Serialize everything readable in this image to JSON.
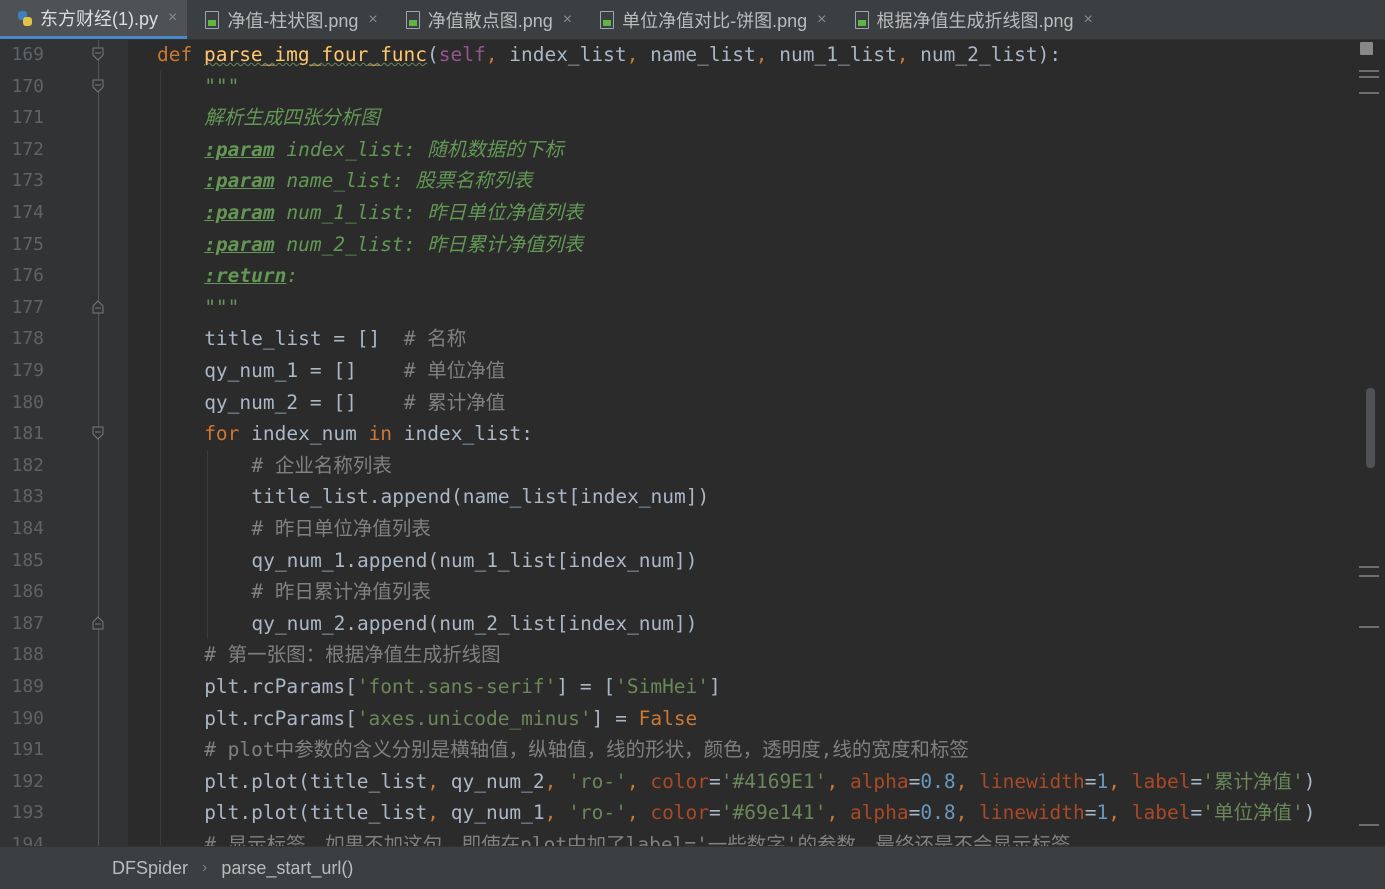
{
  "tabs": [
    {
      "label": "东方财经(1).py",
      "type": "py",
      "active": true
    },
    {
      "label": "净值-柱状图.png",
      "type": "img",
      "active": false
    },
    {
      "label": "净值散点图.png",
      "type": "img",
      "active": false
    },
    {
      "label": "单位净值对比-饼图.png",
      "type": "img",
      "active": false
    },
    {
      "label": "根据净值生成折线图.png",
      "type": "img",
      "active": false
    }
  ],
  "tab_close_glyph": "×",
  "code_lines": [
    {
      "n": "169",
      "fold": "open",
      "indent": 0,
      "segs": [
        [
          "kw",
          "def "
        ],
        [
          "fn",
          "parse_img_four_func"
        ],
        [
          "plain",
          "("
        ],
        [
          "self",
          "self"
        ],
        [
          "kw",
          ", "
        ],
        [
          "plain",
          "index_list"
        ],
        [
          "kw",
          ", "
        ],
        [
          "plain",
          "name_list"
        ],
        [
          "kw",
          ", "
        ],
        [
          "plain",
          "num_1_list"
        ],
        [
          "kw",
          ", "
        ],
        [
          "plain",
          "num_2_list"
        ],
        [
          "plain",
          "):"
        ]
      ]
    },
    {
      "n": "170",
      "fold": "open",
      "indent": 1,
      "segs": [
        [
          "doc-mono",
          "\"\"\""
        ]
      ]
    },
    {
      "n": "171",
      "fold": "",
      "indent": 1,
      "segs": [
        [
          "doc",
          "解析生成四张分析图"
        ]
      ]
    },
    {
      "n": "172",
      "fold": "",
      "indent": 1,
      "segs": [
        [
          "doc-tag",
          ":param"
        ],
        [
          "doc-mono",
          " index_list: "
        ],
        [
          "doc",
          "随机数据的下标"
        ]
      ]
    },
    {
      "n": "173",
      "fold": "",
      "indent": 1,
      "segs": [
        [
          "doc-tag",
          ":param"
        ],
        [
          "doc-mono",
          " name_list: "
        ],
        [
          "doc",
          "股票名称列表"
        ]
      ]
    },
    {
      "n": "174",
      "fold": "",
      "indent": 1,
      "segs": [
        [
          "doc-tag",
          ":param"
        ],
        [
          "doc-mono",
          " num_1_list: "
        ],
        [
          "doc",
          "昨日单位净值列表"
        ]
      ]
    },
    {
      "n": "175",
      "fold": "",
      "indent": 1,
      "segs": [
        [
          "doc-tag",
          ":param"
        ],
        [
          "doc-mono",
          " num_2_list: "
        ],
        [
          "doc",
          "昨日累计净值列表"
        ]
      ]
    },
    {
      "n": "176",
      "fold": "",
      "indent": 1,
      "segs": [
        [
          "doc-tag",
          ":return"
        ],
        [
          "doc-mono",
          ":"
        ]
      ]
    },
    {
      "n": "177",
      "fold": "close",
      "indent": 1,
      "segs": [
        [
          "doc-mono",
          "\"\"\""
        ]
      ]
    },
    {
      "n": "178",
      "fold": "",
      "indent": 1,
      "segs": [
        [
          "plain",
          "title_list = []  "
        ],
        [
          "cmt",
          "# 名称"
        ]
      ]
    },
    {
      "n": "179",
      "fold": "",
      "indent": 1,
      "segs": [
        [
          "plain",
          "qy_num_1 = []    "
        ],
        [
          "cmt",
          "# 单位净值"
        ]
      ]
    },
    {
      "n": "180",
      "fold": "",
      "indent": 1,
      "segs": [
        [
          "plain",
          "qy_num_2 = []    "
        ],
        [
          "cmt",
          "# 累计净值"
        ]
      ]
    },
    {
      "n": "181",
      "fold": "open",
      "indent": 1,
      "segs": [
        [
          "kw",
          "for "
        ],
        [
          "plain",
          "index_num "
        ],
        [
          "kw",
          "in "
        ],
        [
          "plain",
          "index_list:"
        ]
      ]
    },
    {
      "n": "182",
      "fold": "",
      "indent": 2,
      "segs": [
        [
          "cmt",
          "# 企业名称列表"
        ]
      ]
    },
    {
      "n": "183",
      "fold": "",
      "indent": 2,
      "segs": [
        [
          "plain",
          "title_list.append(name_list[index_num])"
        ]
      ]
    },
    {
      "n": "184",
      "fold": "",
      "indent": 2,
      "segs": [
        [
          "cmt",
          "# 昨日单位净值列表"
        ]
      ]
    },
    {
      "n": "185",
      "fold": "",
      "indent": 2,
      "segs": [
        [
          "plain",
          "qy_num_1.append(num_1_list[index_num])"
        ]
      ]
    },
    {
      "n": "186",
      "fold": "",
      "indent": 2,
      "segs": [
        [
          "cmt",
          "# 昨日累计净值列表"
        ]
      ]
    },
    {
      "n": "187",
      "fold": "close",
      "indent": 2,
      "segs": [
        [
          "plain",
          "qy_num_2.append(num_2_list[index_num])"
        ]
      ]
    },
    {
      "n": "188",
      "fold": "",
      "indent": 1,
      "segs": [
        [
          "cmt",
          "# 第一张图：根据净值生成折线图"
        ]
      ]
    },
    {
      "n": "189",
      "fold": "",
      "indent": 1,
      "segs": [
        [
          "plain",
          "plt.rcParams["
        ],
        [
          "str",
          "'font.sans-serif'"
        ],
        [
          "plain",
          "] = ["
        ],
        [
          "str",
          "'SimHei'"
        ],
        [
          "plain",
          "]"
        ]
      ]
    },
    {
      "n": "190",
      "fold": "",
      "indent": 1,
      "segs": [
        [
          "plain",
          "plt.rcParams["
        ],
        [
          "str",
          "'axes.unicode_minus'"
        ],
        [
          "plain",
          "] = "
        ],
        [
          "kw",
          "False"
        ]
      ]
    },
    {
      "n": "191",
      "fold": "",
      "indent": 1,
      "segs": [
        [
          "cmt",
          "# plot中参数的含义分别是横轴值，纵轴值，线的形状，颜色，透明度,线的宽度和标签"
        ]
      ]
    },
    {
      "n": "192",
      "fold": "",
      "indent": 1,
      "segs": [
        [
          "plain",
          "plt.plot(title_list"
        ],
        [
          "kw",
          ", "
        ],
        [
          "plain",
          "qy_num_2"
        ],
        [
          "kw",
          ", "
        ],
        [
          "str",
          "'ro-'"
        ],
        [
          "kw",
          ", "
        ],
        [
          "param",
          "color"
        ],
        [
          "plain",
          "="
        ],
        [
          "str",
          "'#4169E1'"
        ],
        [
          "kw",
          ", "
        ],
        [
          "param",
          "alpha"
        ],
        [
          "plain",
          "="
        ],
        [
          "num",
          "0.8"
        ],
        [
          "kw",
          ", "
        ],
        [
          "param",
          "linewidth"
        ],
        [
          "plain",
          "="
        ],
        [
          "num",
          "1"
        ],
        [
          "kw",
          ", "
        ],
        [
          "param",
          "label"
        ],
        [
          "plain",
          "="
        ],
        [
          "str",
          "'累计净值'"
        ],
        [
          "plain",
          ")"
        ]
      ]
    },
    {
      "n": "193",
      "fold": "",
      "indent": 1,
      "segs": [
        [
          "plain",
          "plt.plot(title_list"
        ],
        [
          "kw",
          ", "
        ],
        [
          "plain",
          "qy_num_1"
        ],
        [
          "kw",
          ", "
        ],
        [
          "str",
          "'ro-'"
        ],
        [
          "kw",
          ", "
        ],
        [
          "param",
          "color"
        ],
        [
          "plain",
          "="
        ],
        [
          "str",
          "'#69e141'"
        ],
        [
          "kw",
          ", "
        ],
        [
          "param",
          "alpha"
        ],
        [
          "plain",
          "="
        ],
        [
          "num",
          "0.8"
        ],
        [
          "kw",
          ", "
        ],
        [
          "param",
          "linewidth"
        ],
        [
          "plain",
          "="
        ],
        [
          "num",
          "1"
        ],
        [
          "kw",
          ", "
        ],
        [
          "param",
          "label"
        ],
        [
          "plain",
          "="
        ],
        [
          "str",
          "'单位净值'"
        ],
        [
          "plain",
          ")"
        ]
      ]
    },
    {
      "n": "194",
      "fold": "",
      "indent": 1,
      "segs": [
        [
          "cmt",
          "# 显示标签，如果不加这句，即使在plot中加了label='一些数字'的参数，最终还是不会显示标签"
        ]
      ]
    }
  ],
  "breadcrumb": {
    "items": [
      "DFSpider",
      "parse_start_url()"
    ],
    "separator": "›"
  },
  "colors": {
    "background": "#2b2b2b",
    "keyword": "#cc7832",
    "function": "#ffc66d",
    "string": "#6a8759",
    "docstring": "#629755",
    "comment": "#808080",
    "number": "#6897bb",
    "param": "#aa4926",
    "self": "#94558d"
  }
}
